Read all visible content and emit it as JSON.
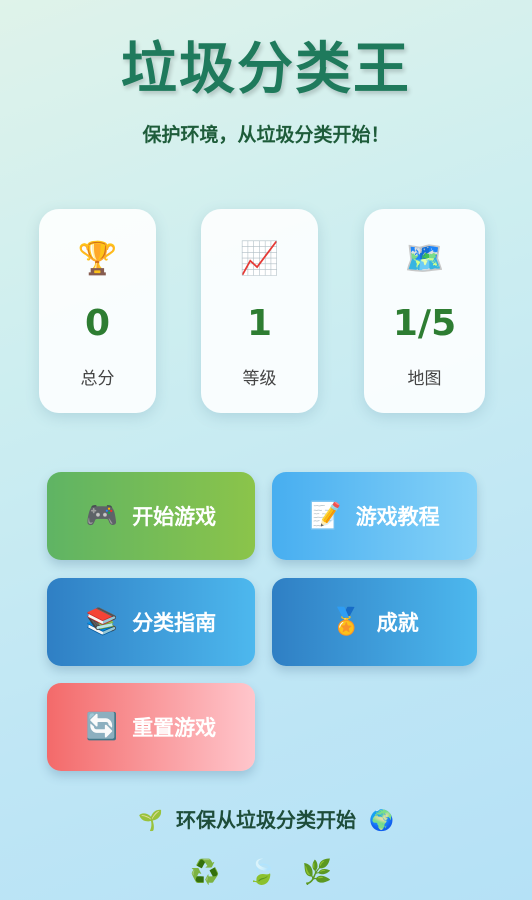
{
  "header": {
    "title": "垃圾分类王",
    "subtitle": "保护环境，从垃圾分类开始！"
  },
  "stats": [
    {
      "icon": "🏆",
      "icon_name": "trophy-icon",
      "value": "0",
      "label": "总分"
    },
    {
      "icon": "📈",
      "icon_name": "chart-increasing-icon",
      "value": "1",
      "label": "等级"
    },
    {
      "icon": "🗺️",
      "icon_name": "world-map-icon",
      "value": "1/5",
      "label": "地图"
    }
  ],
  "buttons": {
    "start": {
      "icon": "🎮",
      "label": "开始游戏"
    },
    "tutorial": {
      "icon": "📝",
      "label": "游戏教程"
    },
    "guide": {
      "icon": "📚",
      "label": "分类指南"
    },
    "achievements": {
      "icon": "🏅",
      "label": "成就"
    },
    "reset": {
      "icon": "🔄",
      "label": "重置游戏"
    }
  },
  "footer": {
    "left_icon": "🌱",
    "text": "环保从垃圾分类开始",
    "right_icon": "🌍"
  },
  "decorations": [
    "♻️",
    "🍃",
    "🌿"
  ],
  "colors": {
    "title": "#1f7a5c",
    "stat_value": "#2e7d32",
    "start_button": "#5fb464",
    "tutorial_button": "#47aef0",
    "guide_button": "#2f7fc4",
    "reset_button": "#f36a6a"
  }
}
